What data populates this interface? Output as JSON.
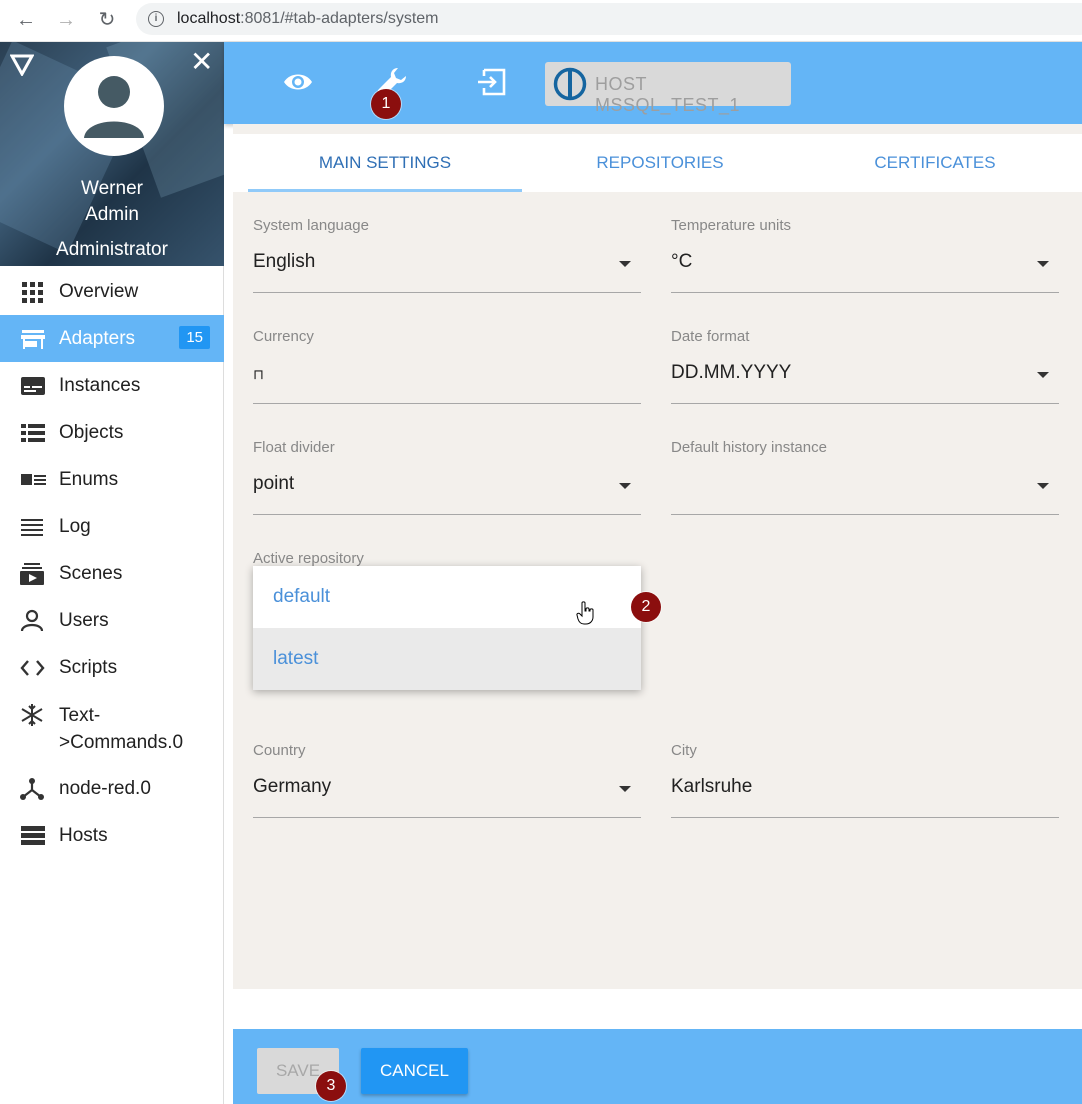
{
  "browser": {
    "url_host": "localhost",
    "url_rest": ":8081/#tab-adapters/system"
  },
  "profile": {
    "first_name": "Werner",
    "last_name": "Admin",
    "role": "Administrator"
  },
  "sidebar": {
    "items": [
      {
        "label": "Overview",
        "icon": "grid-icon"
      },
      {
        "label": "Adapters",
        "icon": "store-icon",
        "badge": "15",
        "active": true
      },
      {
        "label": "Instances",
        "icon": "instances-icon"
      },
      {
        "label": "Objects",
        "icon": "list-icon"
      },
      {
        "label": "Enums",
        "icon": "enums-icon"
      },
      {
        "label": "Log",
        "icon": "log-icon"
      },
      {
        "label": "Scenes",
        "icon": "scenes-icon"
      },
      {
        "label": "Users",
        "icon": "user-icon"
      },
      {
        "label": "Scripts",
        "icon": "code-icon"
      },
      {
        "label": "Text-\n>Commands.0",
        "icon": "snowflake-icon"
      },
      {
        "label": "node-red.0",
        "icon": "node-red-icon"
      },
      {
        "label": "Hosts",
        "icon": "hosts-icon"
      }
    ]
  },
  "toolbar": {
    "host_label": "HOST MSSQL_TEST_1"
  },
  "markers": [
    "1",
    "2",
    "3"
  ],
  "tabs": [
    "MAIN SETTINGS",
    "REPOSITORIES",
    "CERTIFICATES"
  ],
  "fields": {
    "system_language": {
      "label": "System language",
      "value": "English"
    },
    "temperature_units": {
      "label": "Temperature units",
      "value": "°C"
    },
    "currency": {
      "label": "Currency",
      "value": "⊓"
    },
    "date_format": {
      "label": "Date format",
      "value": "DD.MM.YYYY"
    },
    "float_divider": {
      "label": "Float divider",
      "value": "point"
    },
    "default_history": {
      "label": "Default history instance",
      "value": ""
    },
    "active_repository": {
      "label": "Active repository"
    },
    "country": {
      "label": "Country",
      "value": "Germany"
    },
    "city": {
      "label": "City",
      "value": "Karlsruhe"
    }
  },
  "repo_options": [
    "default",
    "latest"
  ],
  "footer": {
    "save_label": "SAVE",
    "cancel_label": "CANCEL"
  },
  "colors": {
    "primary": "#64b5f6",
    "accent": "#2196f3",
    "marker": "#8b0e0e"
  }
}
